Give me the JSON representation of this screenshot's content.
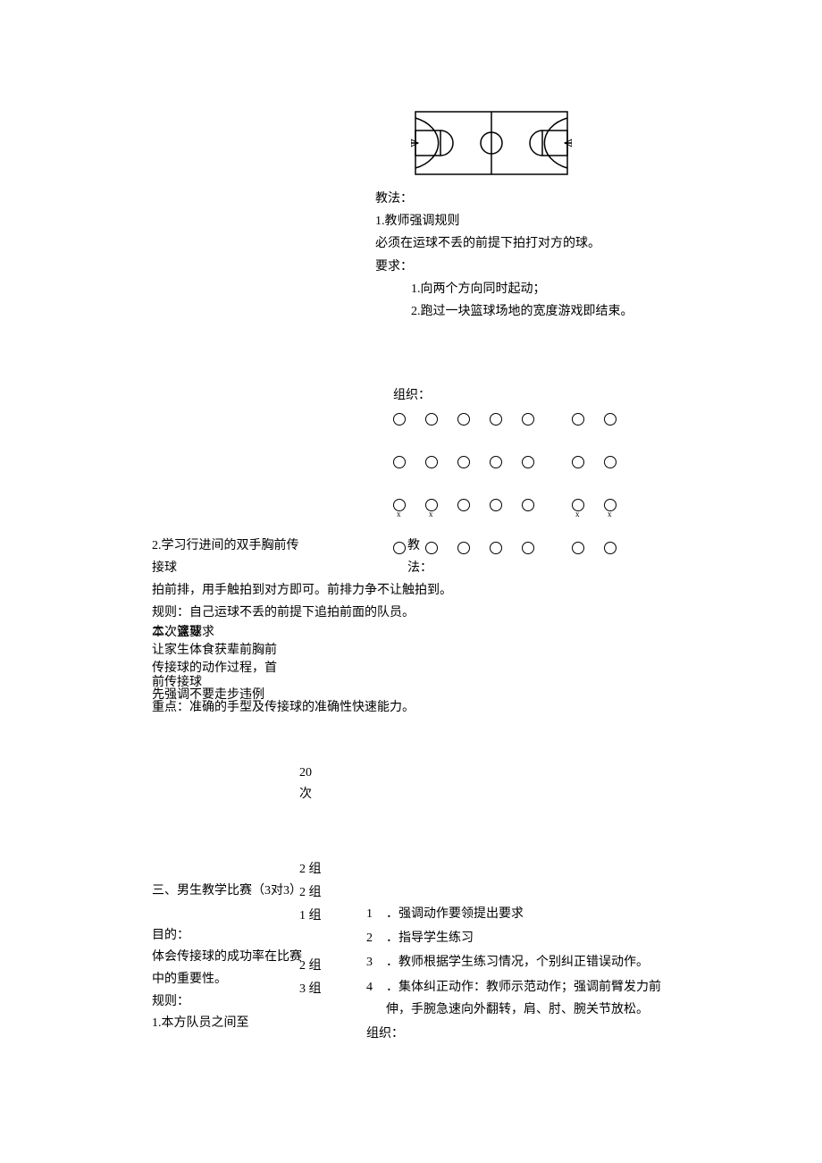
{
  "section1": {
    "teach_law_label": "教法：",
    "rule1": "1.教师强调规则",
    "rule1_body": "必须在运球不丢的前提下拍打对方的球。",
    "require_label": "要求：",
    "req1": "1.向两个方向同时起动；",
    "req2": "2.跑过一块篮球场地的宽度游戏即结束。"
  },
  "section2": {
    "org_label": "组织：",
    "row3_x": [
      "x",
      "x",
      "x",
      "x"
    ]
  },
  "left": {
    "item2": "2.学习行进间的双手胸前传接球",
    "teach_law": "教法：",
    "line1": "拍前排，用手触拍到对方即可。前排力争不让触拍到。",
    "line2": "规则：自己运球不丢的前提下追拍前面的队员。",
    "overlap1": "本次课要求",
    "overlap1b": "二、篮球",
    "overlap2": "让家生体食获辈前胸前",
    "overlap3": "传接球的动作过程，首",
    "overlap3b": "前传接球",
    "overlap4": "先强调不要走步违例",
    "overlap5": "重点：准确的手型及传接球的准确性快速能力。"
  },
  "mid": {
    "count20": "20",
    "countci": "次",
    "g2a": "2 组",
    "g2b": "2 组",
    "g1": "1 组",
    "g2c": "2 组",
    "g3": "3 组"
  },
  "left2": {
    "title3": "三、男生教学比赛（3对3）",
    "mude": "目的：",
    "body1": "体会传接球的成功率在比赛中的重要性。",
    "guize": "规则：",
    "body2": "1.本方队员之间至"
  },
  "bullets": {
    "items": [
      {
        "n": "1",
        "t": "．强调动作要领提出要求"
      },
      {
        "n": "2",
        "t": "．指导学生练习"
      },
      {
        "n": "3",
        "t": "．教师根据学生练习情况，个别纠正错误动作。"
      },
      {
        "n": "4",
        "t": "．集体纠正动作：教师示范动作；强调前臂发力前伸，手腕急速向外翻转，肩、肘、腕关节放松。"
      }
    ],
    "org": "组织："
  }
}
